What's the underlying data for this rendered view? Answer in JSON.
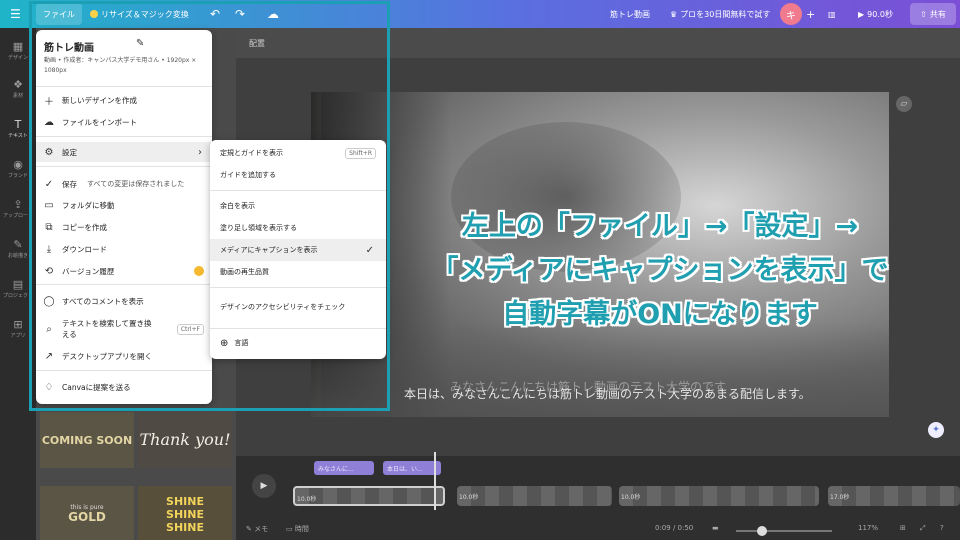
{
  "topbar": {
    "file": "ファイル",
    "resize": "リサイズ＆マジック変換",
    "doc_title": "筋トレ動画",
    "trial": "プロを30日間無料で試す",
    "avatar_initial": "キ",
    "duration": "90.0秒",
    "share": "共有"
  },
  "rail": [
    {
      "label": "デザイン",
      "icon": "▦"
    },
    {
      "label": "素材",
      "icon": "❖"
    },
    {
      "label": "テキスト",
      "icon": "T"
    },
    {
      "label": "ブランド",
      "icon": "◉"
    },
    {
      "label": "アップロード",
      "icon": "⇪"
    },
    {
      "label": "お絵描き",
      "icon": "✎"
    },
    {
      "label": "プロジェクト",
      "icon": "▤"
    },
    {
      "label": "アプリ",
      "icon": "⊞"
    }
  ],
  "panel": {
    "tile1": "COMING SOON",
    "tile2": "Thank you!",
    "tile3_small": "this is pure",
    "tile3": "GOLD",
    "tile4": "SHINE SHINE SHINE"
  },
  "canvas": {
    "arrange": "配置",
    "caption": "本日は、みなさんこんにちは筋トレ動画のテスト大学のあまる配信します。",
    "caption_ghost": "みなさんこんにちは筋トレ動画のテスト大学のです",
    "overlay_line1": "左上の「ファイル」→「設定」→",
    "overlay_line2": "「メディアにキャプションを表示」で",
    "overlay_line3": "自動字幕がONになります"
  },
  "file_menu": {
    "title": "筋トレ動画",
    "subtitle": "動画 • 作成者：キャンパス大学デモ用さん • 1920px × 1080px",
    "items": [
      {
        "label": "新しいデザインを作成",
        "icon": "＋"
      },
      {
        "label": "ファイルをインポート",
        "icon": "☁"
      },
      {
        "label": "設定",
        "icon": "⚙"
      },
      {
        "label": "保存",
        "icon": "✓",
        "note": "すべての変更は保存されました"
      },
      {
        "label": "フォルダに移動",
        "icon": "▭"
      },
      {
        "label": "コピーを作成",
        "icon": "⧉"
      },
      {
        "label": "ダウンロード",
        "icon": "⤓"
      },
      {
        "label": "バージョン履歴",
        "icon": "⟲"
      },
      {
        "label": "すべてのコメントを表示",
        "icon": "◯"
      },
      {
        "label": "テキストを検索して置き換える",
        "icon": "⌕",
        "shortcut": "Ctrl+F"
      },
      {
        "label": "デスクトップアプリを開く",
        "icon": "↗"
      },
      {
        "label": "Canvaに提案を送る",
        "icon": "♢"
      }
    ]
  },
  "settings_menu": {
    "items": [
      {
        "label": "定規とガイドを表示",
        "shortcut": "Shift+R"
      },
      {
        "label": "ガイドを追加する"
      },
      {
        "label": "余白を表示"
      },
      {
        "label": "塗り足し領域を表示する"
      },
      {
        "label": "メディアにキャプションを表示",
        "checked": "✓"
      },
      {
        "label": "動画の再生品質"
      },
      {
        "label": "デザインのアクセシビリティをチェック"
      },
      {
        "label": "言語"
      }
    ]
  },
  "timeline": {
    "chip1": "みなさんに...",
    "chip2": "本日は、い...",
    "clip_label": "10.0秒",
    "clip2": "10.0秒",
    "clip3": "10.0秒",
    "clip4": "17.0秒",
    "notes": "メモ",
    "timer": "時間",
    "time": "0:09 / 0:50",
    "zoom": "117%"
  }
}
